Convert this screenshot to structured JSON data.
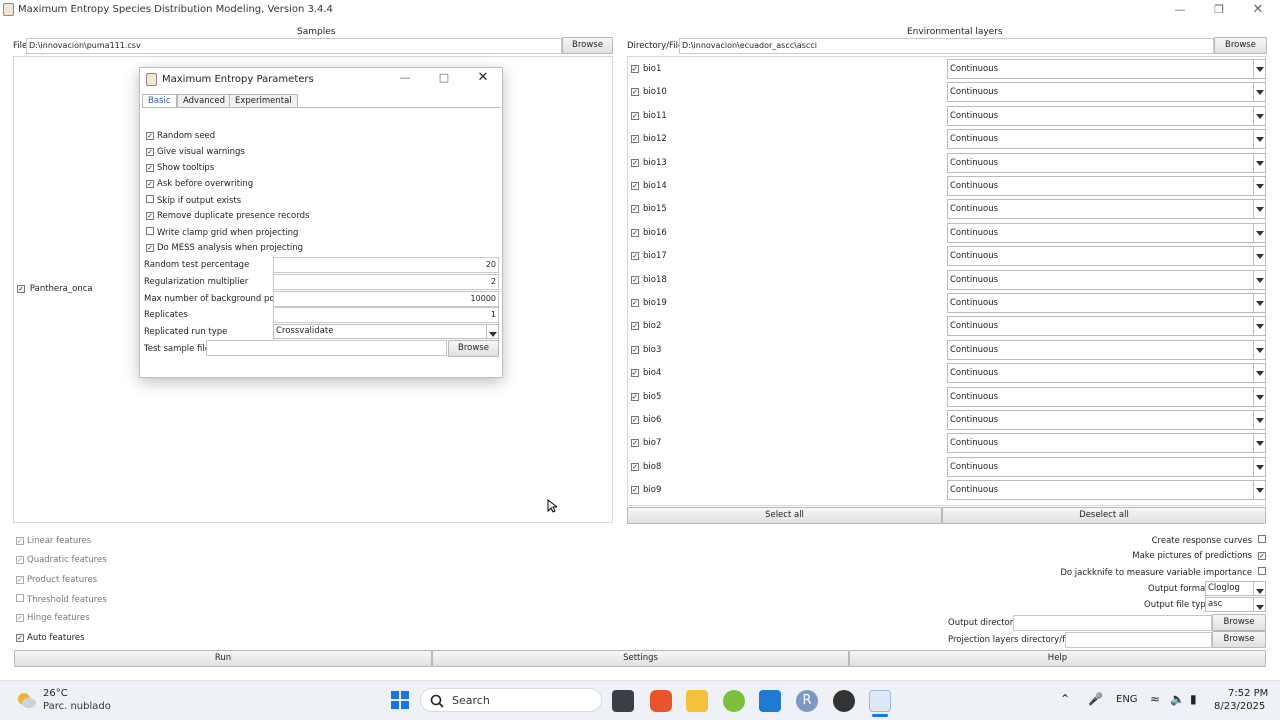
{
  "window": {
    "title": "Maximum Entropy Species Distribution Modeling, Version 3.4.4",
    "controls": [
      "minimize",
      "maximize",
      "close"
    ]
  },
  "samples": {
    "header": "Samples",
    "file_label": "File",
    "file_value": "D:\\innovacion\\puma111.csv",
    "browse": "Browse",
    "species": [
      {
        "name": "Panthera_onca",
        "checked": true
      }
    ]
  },
  "env": {
    "header": "Environmental layers",
    "dir_label": "Directory/File",
    "dir_value": "D:\\innovacion\\ecuador_ascc\\ascci",
    "browse": "Browse",
    "layers": [
      {
        "name": "bio1",
        "type": "Continuous",
        "checked": true
      },
      {
        "name": "bio10",
        "type": "Continuous",
        "checked": true
      },
      {
        "name": "bio11",
        "type": "Continuous",
        "checked": true
      },
      {
        "name": "bio12",
        "type": "Continuous",
        "checked": true
      },
      {
        "name": "bio13",
        "type": "Continuous",
        "checked": true
      },
      {
        "name": "bio14",
        "type": "Continuous",
        "checked": true
      },
      {
        "name": "bio15",
        "type": "Continuous",
        "checked": true
      },
      {
        "name": "bio16",
        "type": "Continuous",
        "checked": true
      },
      {
        "name": "bio17",
        "type": "Continuous",
        "checked": true
      },
      {
        "name": "bio18",
        "type": "Continuous",
        "checked": true
      },
      {
        "name": "bio19",
        "type": "Continuous",
        "checked": true
      },
      {
        "name": "bio2",
        "type": "Continuous",
        "checked": true
      },
      {
        "name": "bio3",
        "type": "Continuous",
        "checked": true
      },
      {
        "name": "bio4",
        "type": "Continuous",
        "checked": true
      },
      {
        "name": "bio5",
        "type": "Continuous",
        "checked": true
      },
      {
        "name": "bio6",
        "type": "Continuous",
        "checked": true
      },
      {
        "name": "bio7",
        "type": "Continuous",
        "checked": true
      },
      {
        "name": "bio8",
        "type": "Continuous",
        "checked": true
      },
      {
        "name": "bio9",
        "type": "Continuous",
        "checked": true
      }
    ],
    "select_all": "Select all",
    "deselect_all": "Deselect all"
  },
  "features": [
    {
      "label": "Linear features",
      "checked": true,
      "enabled": false
    },
    {
      "label": "Quadratic features",
      "checked": true,
      "enabled": false
    },
    {
      "label": "Product features",
      "checked": true,
      "enabled": false
    },
    {
      "label": "Threshold features",
      "checked": false,
      "enabled": false
    },
    {
      "label": "Hinge features",
      "checked": true,
      "enabled": false
    },
    {
      "label": "Auto features",
      "checked": true,
      "enabled": true
    }
  ],
  "options": {
    "response_curves": {
      "label": "Create response curves",
      "checked": false
    },
    "pictures": {
      "label": "Make pictures of predictions",
      "checked": true
    },
    "jackknife": {
      "label": "Do jackknife to measure variable importance",
      "checked": false
    },
    "output_format_label": "Output format",
    "output_format": "Cloglog",
    "output_file_type_label": "Output file type",
    "output_file_type": "asc",
    "output_dir_label": "Output directory",
    "output_dir_value": "",
    "proj_label": "Projection layers directory/file",
    "proj_value": "",
    "browse": "Browse"
  },
  "bottom_buttons": {
    "run": "Run",
    "settings": "Settings",
    "help": "Help"
  },
  "dialog": {
    "title": "Maximum Entropy Parameters",
    "tabs": [
      "Basic",
      "Advanced",
      "Experimental"
    ],
    "active_tab": "Basic",
    "checkboxes": [
      {
        "label": "Random seed",
        "checked": true
      },
      {
        "label": "Give visual warnings",
        "checked": true
      },
      {
        "label": "Show tooltips",
        "checked": true
      },
      {
        "label": "Ask before overwriting",
        "checked": true
      },
      {
        "label": "Skip if output exists",
        "checked": false
      },
      {
        "label": "Remove duplicate presence records",
        "checked": true
      },
      {
        "label": "Write clamp grid when projecting",
        "checked": false
      },
      {
        "label": "Do MESS analysis when projecting",
        "checked": true
      }
    ],
    "fields": {
      "random_test_label": "Random test percentage",
      "random_test_value": "20",
      "reg_mult_label": "Regularization multiplier",
      "reg_mult_value": "2",
      "max_bg_label": "Max number of background points",
      "max_bg_value": "10000",
      "replicates_label": "Replicates",
      "replicates_value": "1",
      "run_type_label": "Replicated run type",
      "run_type_value": "Crossvalidate",
      "test_file_label": "Test sample file",
      "test_file_value": "",
      "browse": "Browse"
    }
  },
  "taskbar": {
    "weather_temp": "26°C",
    "weather_desc": "Parc. nublado",
    "search": "Search",
    "lang": "ENG",
    "time": "7:52 PM",
    "date": "8/23/2025"
  }
}
